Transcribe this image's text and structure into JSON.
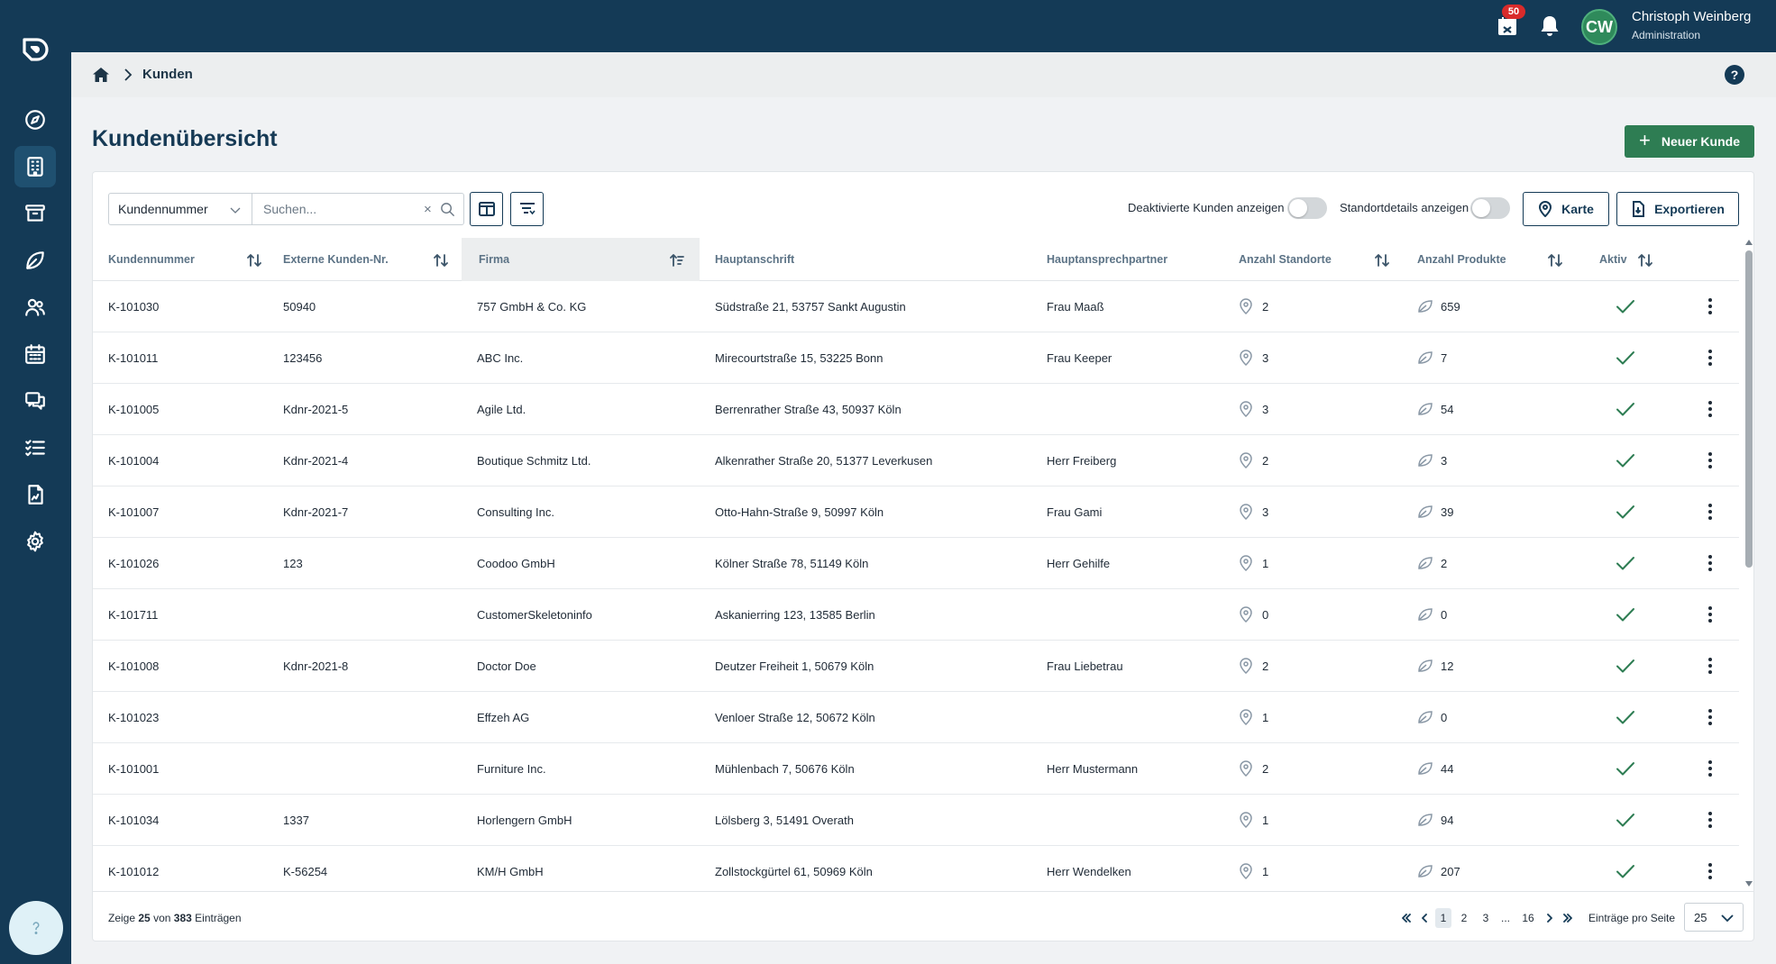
{
  "topbar": {
    "notification_count": "50",
    "avatar_initials": "CW",
    "user_name": "Christoph Weinberg",
    "user_role": "Administration"
  },
  "breadcrumb": {
    "current": "Kunden",
    "help_label": "?"
  },
  "page": {
    "title": "Kundenübersicht",
    "new_button_label": "Neuer Kunde"
  },
  "toolbar": {
    "filter_select_value": "Kundennummer",
    "search_placeholder": "Suchen...",
    "clear_label": "×",
    "toggle_deactivated_label": "Deaktivierte Kunden anzeigen",
    "toggle_location_label": "Standortdetails anzeigen",
    "map_button_label": "Karte",
    "export_button_label": "Exportieren"
  },
  "table": {
    "headers": {
      "customer_number": "Kundennummer",
      "external_number": "Externe Kunden-Nr.",
      "company": "Firma",
      "address": "Hauptanschrift",
      "contact": "Hauptansprechpartner",
      "locations": "Anzahl Standorte",
      "products": "Anzahl Produkte",
      "active": "Aktiv"
    },
    "rows": [
      {
        "customer_number": "K-101030",
        "external_number": "50940",
        "company": "757 GmbH & Co. KG",
        "address": "Südstraße 21, 53757 Sankt Augustin",
        "contact": "Frau Maaß",
        "locations": "2",
        "products": "659"
      },
      {
        "customer_number": "K-101011",
        "external_number": "123456",
        "company": "ABC Inc.",
        "address": "Mirecourtstraße 15, 53225 Bonn",
        "contact": "Frau Keeper",
        "locations": "3",
        "products": "7"
      },
      {
        "customer_number": "K-101005",
        "external_number": "Kdnr-2021-5",
        "company": "Agile Ltd.",
        "address": "Berrenrather Straße 43, 50937 Köln",
        "contact": "",
        "locations": "3",
        "products": "54"
      },
      {
        "customer_number": "K-101004",
        "external_number": "Kdnr-2021-4",
        "company": "Boutique Schmitz Ltd.",
        "address": "Alkenrather Straße 20, 51377 Leverkusen",
        "contact": "Herr Freiberg",
        "locations": "2",
        "products": "3"
      },
      {
        "customer_number": "K-101007",
        "external_number": "Kdnr-2021-7",
        "company": "Consulting Inc.",
        "address": "Otto-Hahn-Straße 9, 50997 Köln",
        "contact": "Frau Gami",
        "locations": "3",
        "products": "39"
      },
      {
        "customer_number": "K-101026",
        "external_number": "123",
        "company": "Coodoo GmbH",
        "address": "Kölner Straße 78, 51149 Köln",
        "contact": "Herr Gehilfe",
        "locations": "1",
        "products": "2"
      },
      {
        "customer_number": "K-101711",
        "external_number": "",
        "company": "CustomerSkeletoninfo",
        "address": "Askanierring 123, 13585 Berlin",
        "contact": "",
        "locations": "0",
        "products": "0"
      },
      {
        "customer_number": "K-101008",
        "external_number": "Kdnr-2021-8",
        "company": "Doctor Doe",
        "address": "Deutzer Freiheit 1, 50679 Köln",
        "contact": "Frau Liebetrau",
        "locations": "2",
        "products": "12"
      },
      {
        "customer_number": "K-101023",
        "external_number": "",
        "company": "Effzeh AG",
        "address": "Venloer Straße 12, 50672 Köln",
        "contact": "",
        "locations": "1",
        "products": "0"
      },
      {
        "customer_number": "K-101001",
        "external_number": "",
        "company": "Furniture Inc.",
        "address": "Mühlenbach 7, 50676 Köln",
        "contact": "Herr Mustermann",
        "locations": "2",
        "products": "44"
      },
      {
        "customer_number": "K-101034",
        "external_number": "1337",
        "company": "Horlengern GmbH",
        "address": "Lölsberg 3, 51491 Overath",
        "contact": "",
        "locations": "1",
        "products": "94"
      },
      {
        "customer_number": "K-101012",
        "external_number": "K-56254",
        "company": "KM/H GmbH",
        "address": "Zollstockgürtel 61, 50969 Köln",
        "contact": "Herr Wendelken",
        "locations": "1",
        "products": "207"
      }
    ]
  },
  "footer": {
    "summary_prefix": "Zeige",
    "summary_shown": "25",
    "summary_of": "von",
    "summary_total": "383",
    "summary_suffix": "Einträgen",
    "pages": [
      "1",
      "2",
      "3",
      "...",
      "16"
    ],
    "per_page_label": "Einträge pro Seite",
    "per_page_value": "25"
  },
  "colors": {
    "sidebar": "#143a56",
    "accent_green": "#2e7d53",
    "badge_red": "#d92b2b"
  }
}
